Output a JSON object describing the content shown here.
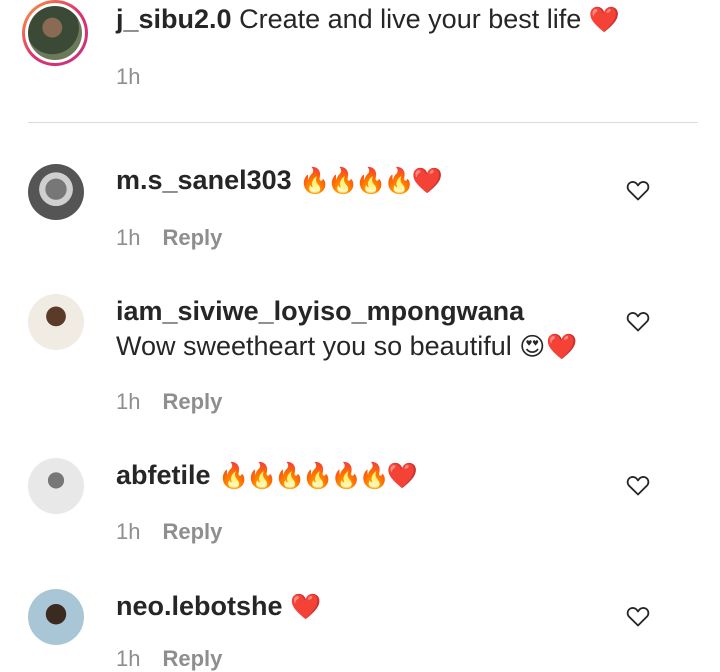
{
  "caption": {
    "username": "j_sibu2.0",
    "text": "Create and live your best life",
    "emoji": "❤️",
    "time": "1h"
  },
  "comments": [
    {
      "username": "m.s_sanel303",
      "text": "",
      "emoji": "🔥🔥🔥🔥❤️",
      "time": "1h",
      "reply_label": "Reply",
      "like_icon": "heart-outline-icon"
    },
    {
      "username": "iam_siviwe_loyiso_mpongwana",
      "text": "Wow sweetheart you so beautiful",
      "emoji": "😍 ❤️",
      "time": "1h",
      "reply_label": "Reply",
      "like_icon": "heart-outline-icon"
    },
    {
      "username": "abfetile",
      "text": "",
      "emoji": "🔥🔥🔥🔥🔥🔥❤️",
      "time": "1h",
      "reply_label": "Reply",
      "like_icon": "heart-outline-icon"
    },
    {
      "username": "neo.lebotshe",
      "text": "",
      "emoji": "❤️",
      "time": "1h",
      "reply_label": "Reply",
      "like_icon": "heart-outline-icon"
    }
  ],
  "colors": {
    "text": "#262626",
    "secondary": "#8e8e8e",
    "divider": "#dbdbdb"
  }
}
